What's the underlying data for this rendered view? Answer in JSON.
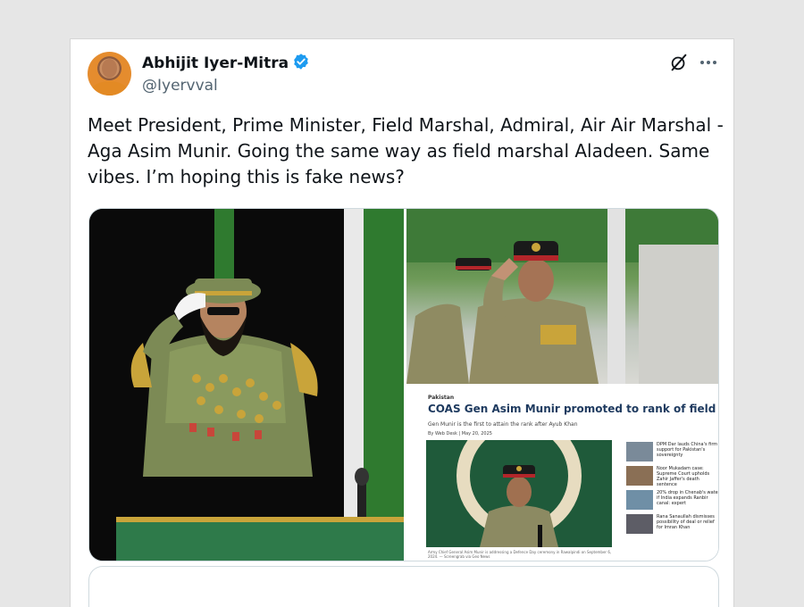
{
  "tweet": {
    "author_name": "Abhijit Iyer-Mitra",
    "handle": "@Iyervval",
    "text": "Meet President, Prime Minister, Field Marshal, Admiral, Air Air Marshal - Aga Asim Munir. Going the same way as field marshal Aladeen. Same vibes. I’m hoping this is fake news?",
    "verified_icon": "verified-badge-icon",
    "colors": {
      "verified": "#1d9bf0",
      "text": "#0f1419",
      "handle": "#536471"
    }
  },
  "header_actions": {
    "grok_icon": "grok-icon",
    "more_icon": "more-icon"
  },
  "media": {
    "news_card": {
      "kicker": "Pakistan",
      "title": "COAS Gen Asim Munir promoted to rank of field marshal",
      "subtitle": "Gen Munir is the first to attain the rank after Ayub Khan",
      "byline": "By Web Desk  |  May 20, 2025",
      "caption": "Army Chief General Asim Munir is addressing a Defence Day ceremony in Rawalpindi on September 6, 2024. — Screengrab via Geo News",
      "sidebar": [
        {
          "text": "DPM Dar lauds China's firm support for Pakistan's sovereignty"
        },
        {
          "text": "Noor Mukadam case: Supreme Court upholds Zahir Jaffer's death sentence"
        },
        {
          "text": "20% drop in Chenab's water if India expands Ranbir canal: expert"
        },
        {
          "text": "Rana Sanaullah dismisses possibility of deal or relief for Imran Khan"
        }
      ]
    }
  }
}
